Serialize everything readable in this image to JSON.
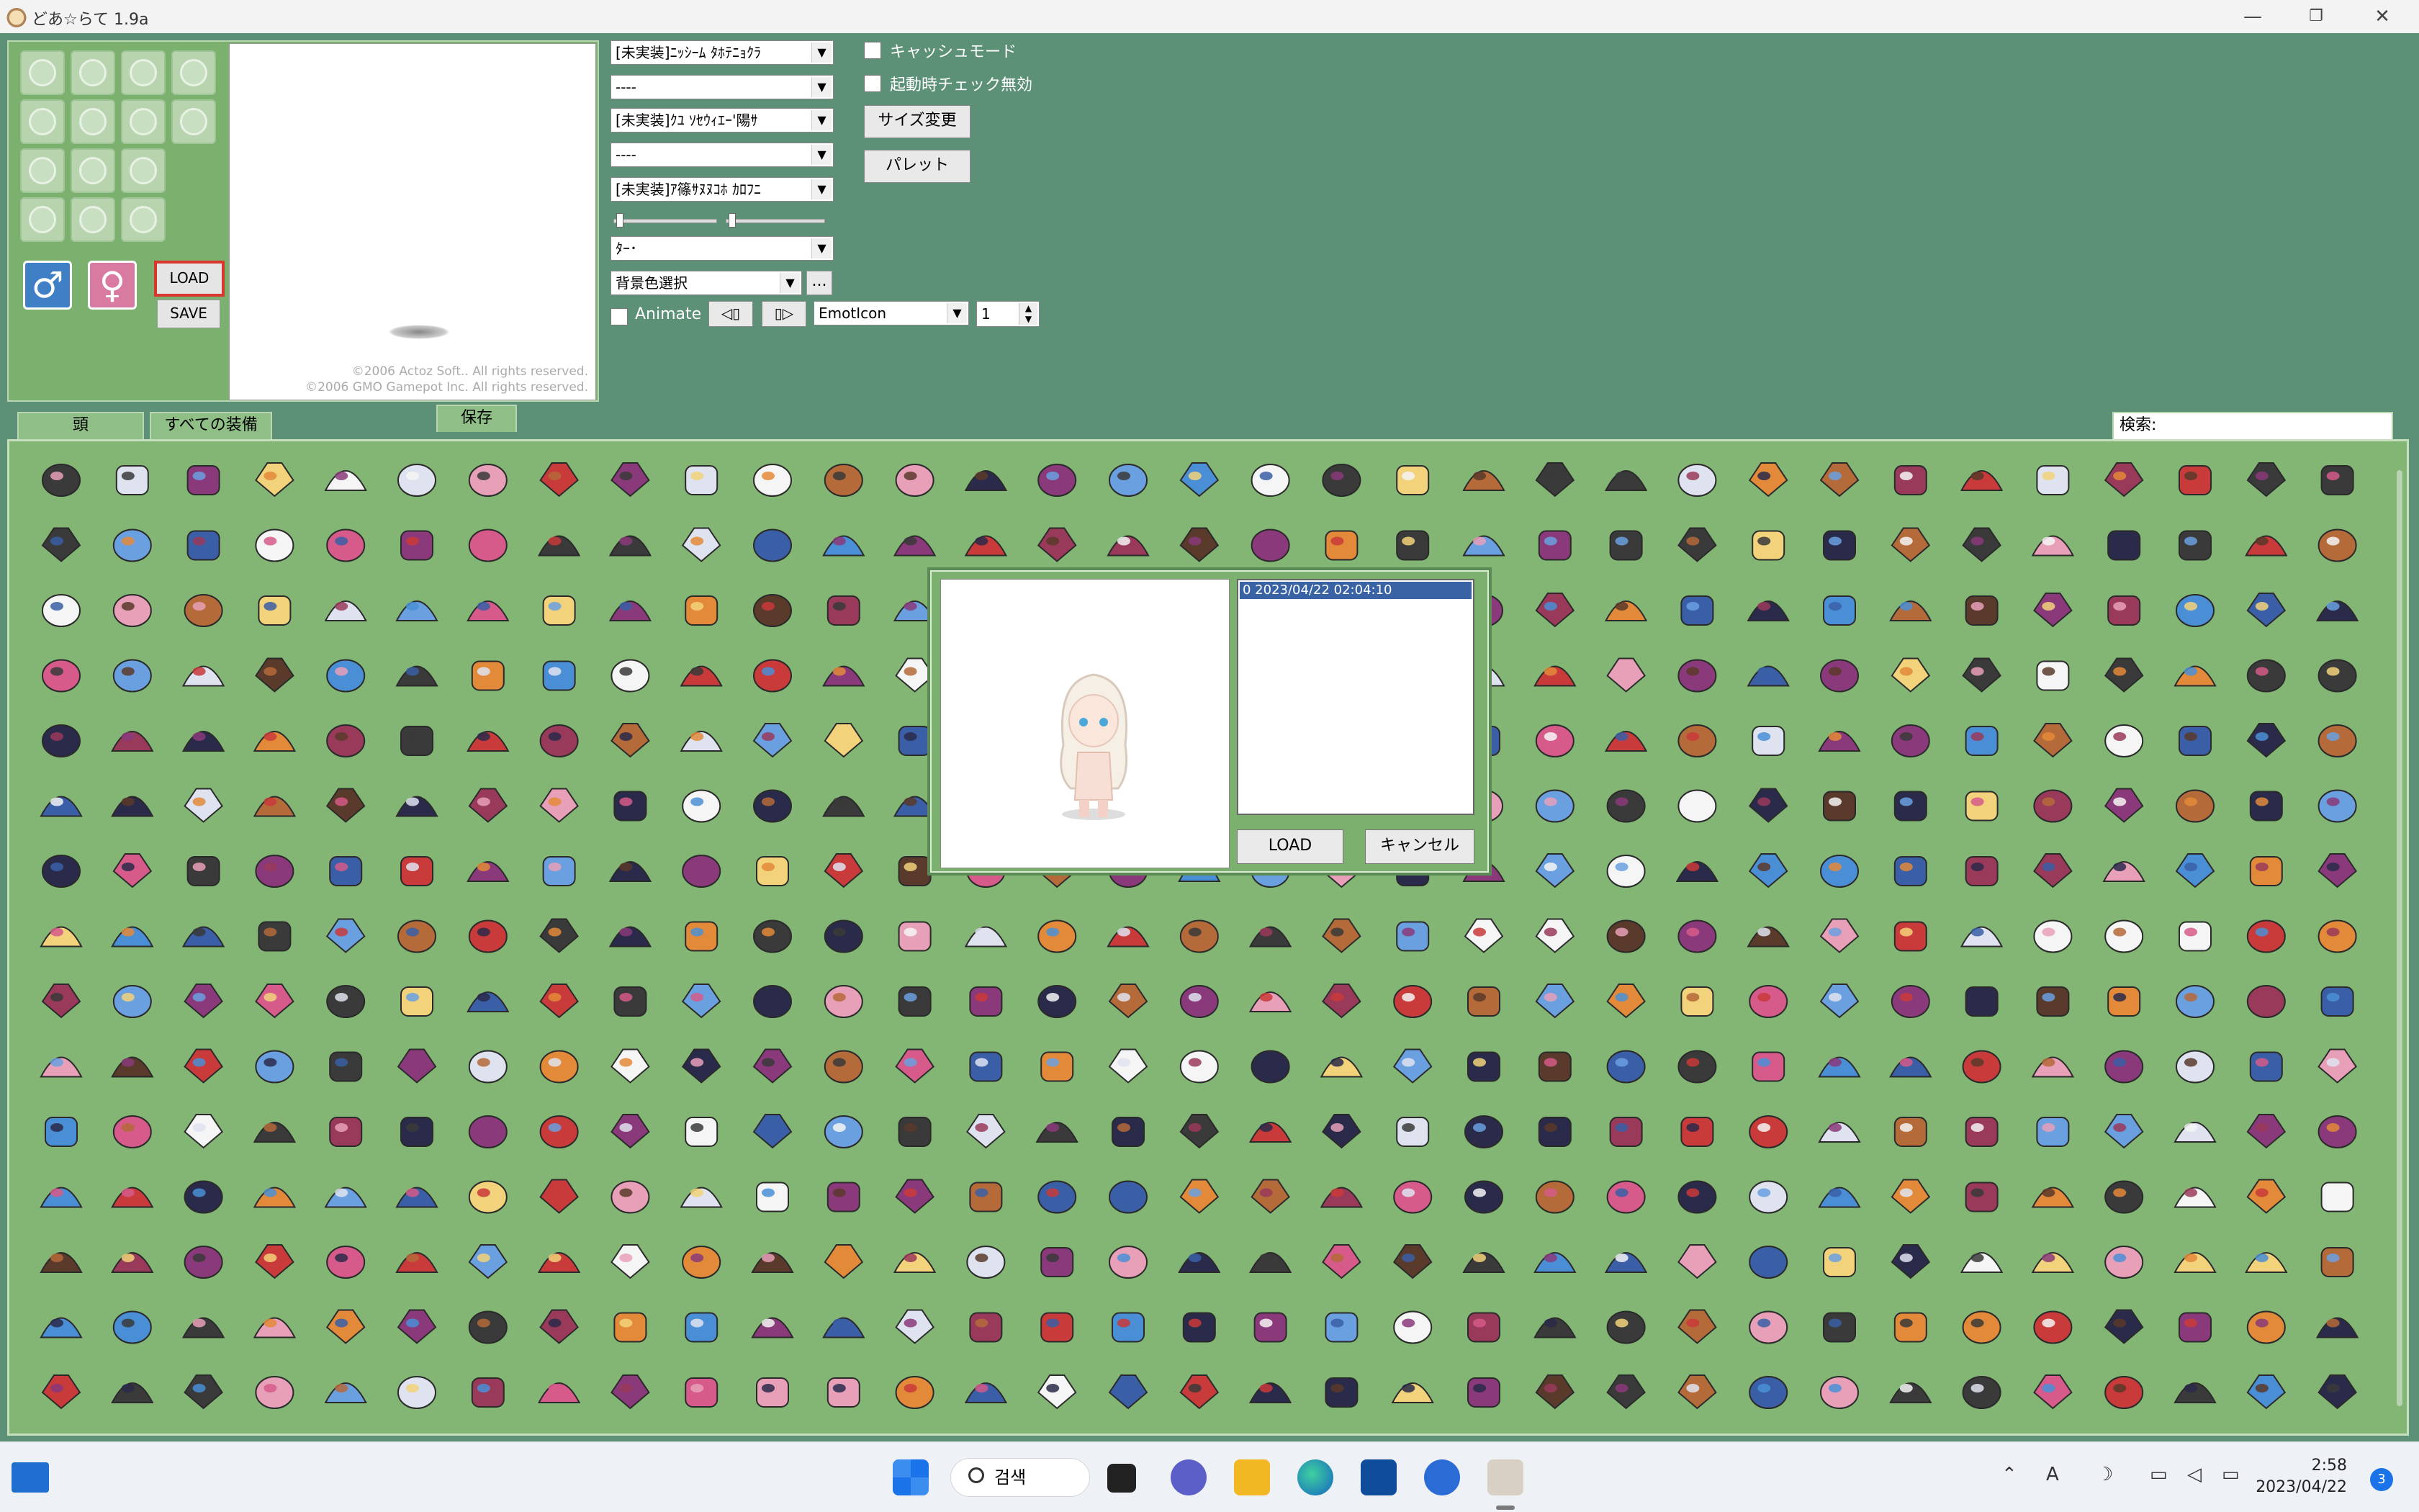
{
  "window": {
    "title": "どあ☆らて 1.9a"
  },
  "preview": {
    "load_label": "LOAD",
    "save_label": "SAVE",
    "copyright_1": "©2006 Actoz Soft.. All rights reserved.",
    "copyright_2": "©2006 GMO Gamepot Inc. All rights reserved."
  },
  "controls": {
    "select_1": "[未実装]ﾆｯｼｰﾑ ﾀﾎﾃﾆｮｸﾗ",
    "select_2": "----",
    "select_3": "[未実装]ｸﾕ ｿｾｳｨｴｰ'陽ｻ",
    "select_4": "----",
    "select_5": "[未実装]ｱ篠ｻﾇﾇｺﾎ ｶﾛﾌﾆ",
    "select_6": "ﾀｰ･",
    "bgcolor_label": "背景色選択",
    "bgcolor_more": "...",
    "animate_label": "Animate",
    "prev_label": "◁▯",
    "next_label": "▯▷",
    "emot_value": "EmotIcon",
    "frame_value": "1",
    "cache_mode": "キャッシュモード",
    "startup_check": "起動時チェック無効",
    "resize_label": "サイズ変更",
    "palette_label": "パレット"
  },
  "tabs": {
    "head": "頭",
    "all": "すべての装備",
    "save": "保存"
  },
  "search": {
    "label": "検索:"
  },
  "dialog": {
    "entry": "0 2023/04/22 02:04:10",
    "load": "LOAD",
    "cancel": "キャンセル"
  },
  "taskbar": {
    "search_label": "검색",
    "time": "2:58",
    "date": "2023/04/22",
    "notifications": "3",
    "ime": "A"
  },
  "items": {
    "palette": [
      "#c93a3a",
      "#8a3a7a",
      "#3a5fa6",
      "#dfe3f0",
      "#e38a3a",
      "#5a3a2a",
      "#f2d27a",
      "#3a3a3a",
      "#e8a0b8",
      "#4a8fd6",
      "#f5f5f5",
      "#9a3a5a",
      "#2a2a4a",
      "#d65a8a",
      "#6aa0e0",
      "#b56a3a"
    ]
  },
  "colors": {
    "background": "#5c9077",
    "panel": "#7bb06f",
    "grid": "#83b575",
    "accent": "#3a63a6"
  }
}
